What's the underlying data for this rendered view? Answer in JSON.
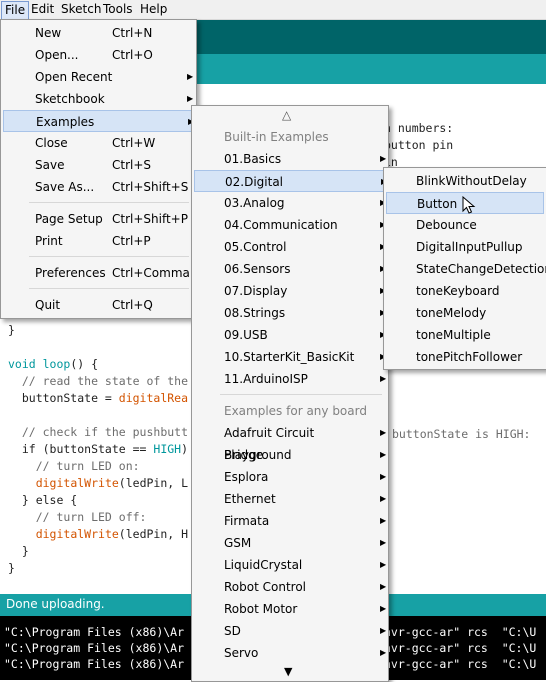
{
  "menubar": [
    "File",
    "Edit",
    "Sketch",
    "Tools",
    "Help"
  ],
  "code_lines": [
    {
      "parts": [
        {
          "t": "}"
        }
      ]
    },
    {
      "parts": [
        {
          "t": ""
        }
      ]
    },
    {
      "parts": [
        {
          "t": "void loop",
          "c": "kw"
        },
        {
          "t": "() {"
        }
      ]
    },
    {
      "parts": [
        {
          "t": "  // read the state of the",
          "c": "com"
        }
      ]
    },
    {
      "parts": [
        {
          "t": "  buttonState = "
        },
        {
          "t": "digitalRea",
          "c": "fn"
        }
      ]
    },
    {
      "parts": [
        {
          "t": ""
        }
      ]
    },
    {
      "parts": [
        {
          "t": "  // check if the pushbutt",
          "c": "com"
        }
      ]
    },
    {
      "parts": [
        {
          "t": "  if (buttonState == "
        },
        {
          "t": "HIGH",
          "c": "kw"
        },
        {
          "t": ")"
        }
      ]
    },
    {
      "parts": [
        {
          "t": "    // turn LED on:",
          "c": "com"
        }
      ]
    },
    {
      "parts": [
        {
          "t": "    "
        },
        {
          "t": "digitalWrite",
          "c": "fn"
        },
        {
          "t": "(ledPin, L"
        }
      ]
    },
    {
      "parts": [
        {
          "t": "  } else {"
        }
      ]
    },
    {
      "parts": [
        {
          "t": "    // turn LED off:",
          "c": "com"
        }
      ]
    },
    {
      "parts": [
        {
          "t": "    "
        },
        {
          "t": "digitalWrite",
          "c": "fn"
        },
        {
          "t": "(ledPin, H"
        }
      ]
    },
    {
      "parts": [
        {
          "t": "  }"
        }
      ]
    },
    {
      "parts": [
        {
          "t": "}"
        }
      ]
    }
  ],
  "right_code": [
    "n numbers:",
    "button pin",
    "in"
  ],
  "right_comment": "buttonState is HIGH:",
  "status": "Done uploading.",
  "console_lines": [
    "\"C:\\Program Files (x86)\\Ar",
    "\"C:\\Program Files (x86)\\Ar",
    "\"C:\\Program Files (x86)\\Ar"
  ],
  "console_right": [
    "avr-gcc-ar\" rcs  \"C:\\U",
    "avr-gcc-ar\" rcs  \"C:\\U",
    "avr-gcc-ar\" rcs  \"C:\\U"
  ],
  "file_menu": [
    {
      "label": "New",
      "shortcut": "Ctrl+N"
    },
    {
      "label": "Open...",
      "shortcut": "Ctrl+O"
    },
    {
      "label": "Open Recent",
      "submenu": true
    },
    {
      "label": "Sketchbook",
      "submenu": true
    },
    {
      "label": "Examples",
      "submenu": true,
      "highlight": true
    },
    {
      "label": "Close",
      "shortcut": "Ctrl+W"
    },
    {
      "label": "Save",
      "shortcut": "Ctrl+S"
    },
    {
      "label": "Save As...",
      "shortcut": "Ctrl+Shift+S"
    },
    {
      "sep": true
    },
    {
      "label": "Page Setup",
      "shortcut": "Ctrl+Shift+P"
    },
    {
      "label": "Print",
      "shortcut": "Ctrl+P"
    },
    {
      "sep": true
    },
    {
      "label": "Preferences",
      "shortcut": "Ctrl+Comma"
    },
    {
      "sep": true
    },
    {
      "label": "Quit",
      "shortcut": "Ctrl+Q"
    }
  ],
  "examples_menu": {
    "up_arrow": "△",
    "down_arrow": "▼",
    "items": [
      {
        "label": "Built-in Examples",
        "header": true
      },
      {
        "label": "01.Basics",
        "submenu": true
      },
      {
        "label": "02.Digital",
        "submenu": true,
        "highlight": true
      },
      {
        "label": "03.Analog",
        "submenu": true
      },
      {
        "label": "04.Communication",
        "submenu": true
      },
      {
        "label": "05.Control",
        "submenu": true
      },
      {
        "label": "06.Sensors",
        "submenu": true
      },
      {
        "label": "07.Display",
        "submenu": true
      },
      {
        "label": "08.Strings",
        "submenu": true
      },
      {
        "label": "09.USB",
        "submenu": true
      },
      {
        "label": "10.StarterKit_BasicKit",
        "submenu": true
      },
      {
        "label": "11.ArduinoISP",
        "submenu": true
      },
      {
        "sep": true
      },
      {
        "label": "Examples for any board",
        "header": true
      },
      {
        "label": "Adafruit Circuit Playground",
        "submenu": true
      },
      {
        "label": "Bridge",
        "submenu": true
      },
      {
        "label": "Esplora",
        "submenu": true
      },
      {
        "label": "Ethernet",
        "submenu": true
      },
      {
        "label": "Firmata",
        "submenu": true
      },
      {
        "label": "GSM",
        "submenu": true
      },
      {
        "label": "LiquidCrystal",
        "submenu": true
      },
      {
        "label": "Robot Control",
        "submenu": true
      },
      {
        "label": "Robot Motor",
        "submenu": true
      },
      {
        "label": "SD",
        "submenu": true
      },
      {
        "label": "Servo",
        "submenu": true
      }
    ]
  },
  "digital_menu": [
    {
      "label": "BlinkWithoutDelay"
    },
    {
      "label": "Button",
      "highlight": true
    },
    {
      "label": "Debounce"
    },
    {
      "label": "DigitalInputPullup"
    },
    {
      "label": "StateChangeDetection"
    },
    {
      "label": "toneKeyboard"
    },
    {
      "label": "toneMelody"
    },
    {
      "label": "toneMultiple"
    },
    {
      "label": "tonePitchFollower"
    }
  ]
}
